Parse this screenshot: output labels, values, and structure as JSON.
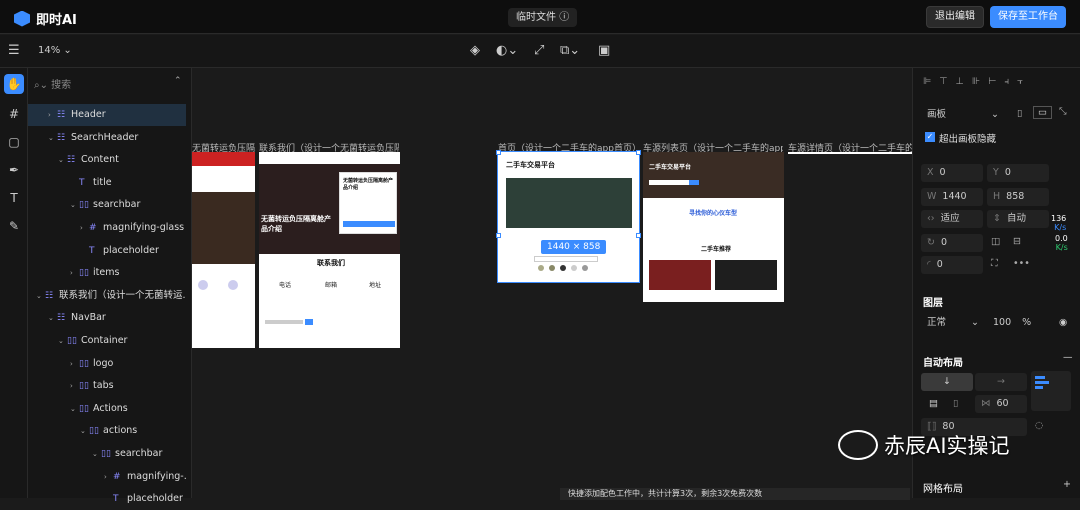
{
  "app": {
    "name": "即时AI",
    "doc_title": "临时文件",
    "exit_label": "退出编辑",
    "save_label": "保存至工作台"
  },
  "toolbar": {
    "zoom": "14%"
  },
  "layers_panel": {
    "search_placeholder": "搜索",
    "items": [
      {
        "label": "Header",
        "selected": true
      },
      {
        "label": "SearchHeader"
      },
      {
        "label": "Content"
      },
      {
        "label": "title"
      },
      {
        "label": "searchbar"
      },
      {
        "label": "magnifying-glass"
      },
      {
        "label": "placeholder"
      },
      {
        "label": "items"
      },
      {
        "label": "联系我们（设计一个无菌转运..."
      },
      {
        "label": "NavBar"
      },
      {
        "label": "Container"
      },
      {
        "label": "logo"
      },
      {
        "label": "tabs"
      },
      {
        "label": "Actions"
      },
      {
        "label": "actions"
      },
      {
        "label": "searchbar"
      },
      {
        "label": "magnifying-..."
      },
      {
        "label": "placeholder"
      }
    ]
  },
  "canvas": {
    "frame_labels": [
      "无菌转运负压隔...",
      "联系我们（设计一个无菌转运负压隔...",
      "首页（设计一个二手车的app首页）",
      "车源列表页（设计一个二手车的app...",
      "车源详情页（设计一个二手车的a"
    ],
    "selection_size": "1440 × 858",
    "frame_texts": {
      "hero_title": "无菌转运负压隔离舱产品介绍",
      "form_title": "无菌转运负压隔离舱产品介绍",
      "contact_title": "联系我们",
      "app_home_title": "二手车交易平台",
      "list_title": "二手车交易平台",
      "list_sub": "寻找你的心仪车型",
      "list_recommend": "二手车推荐",
      "contact_items": [
        "电话",
        "邮箱",
        "地址"
      ]
    }
  },
  "right_panel": {
    "frame_type": "画板",
    "clip_label": "超出画板隐藏",
    "x": "0",
    "y": "0",
    "w": "1440",
    "h": "858",
    "fit_w": "适应",
    "fit_h": "自动",
    "rotation": "0",
    "radius": "0",
    "layer_section": "图层",
    "blend": "正常",
    "opacity": "100",
    "opacity_unit": "%",
    "auto_layout_section": "自动布局",
    "gap": "60",
    "padding": "80",
    "grid_section": "网格布局",
    "speed_up": "136",
    "speed_up_unit": "K/s",
    "speed_down": "0.0",
    "speed_down_unit": "K/s"
  },
  "watermark": {
    "text": "赤辰AI实操记"
  },
  "toast": {
    "text": "快捷添加配色工作中，共计计算3次，剩余3次免费次数"
  },
  "colors": {
    "accent": "#3b8cff",
    "bg": "#1b1b1b",
    "panel": "#161616"
  }
}
